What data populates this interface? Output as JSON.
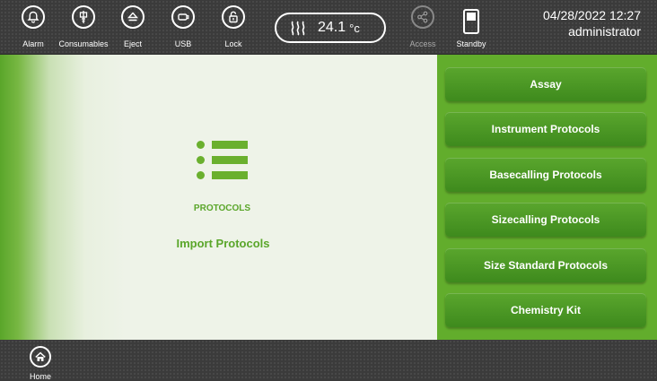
{
  "topbar": {
    "alarm_label": "Alarm",
    "consumables_label": "Consumables",
    "eject_label": "Eject",
    "usb_label": "USB",
    "lock_label": "Lock",
    "temperature_value": "24.1",
    "temperature_unit": "°c",
    "access_label": "Access",
    "standby_label": "Standby",
    "datetime": "04/28/2022 12:27",
    "user": "administrator"
  },
  "main": {
    "section_title": "PROTOCOLS",
    "import_label": "Import Protocols",
    "buttons": [
      {
        "label": "Assay"
      },
      {
        "label": "Instrument Protocols"
      },
      {
        "label": "Basecalling Protocols"
      },
      {
        "label": "Sizecalling Protocols"
      },
      {
        "label": "Size Standard Protocols"
      },
      {
        "label": "Chemistry Kit"
      }
    ]
  },
  "bottombar": {
    "home_label": "Home"
  },
  "icons": [
    "bell-icon",
    "consumables-icon",
    "eject-icon",
    "usb-icon",
    "lock-icon",
    "heater-icon",
    "share-icon",
    "standby-icon",
    "list-icon",
    "home-icon"
  ],
  "colors": {
    "accent_green": "#62ad2c",
    "button_green": "#4a9624",
    "text_green": "#5aa62a",
    "bar_gray": "#3b3b3b"
  }
}
